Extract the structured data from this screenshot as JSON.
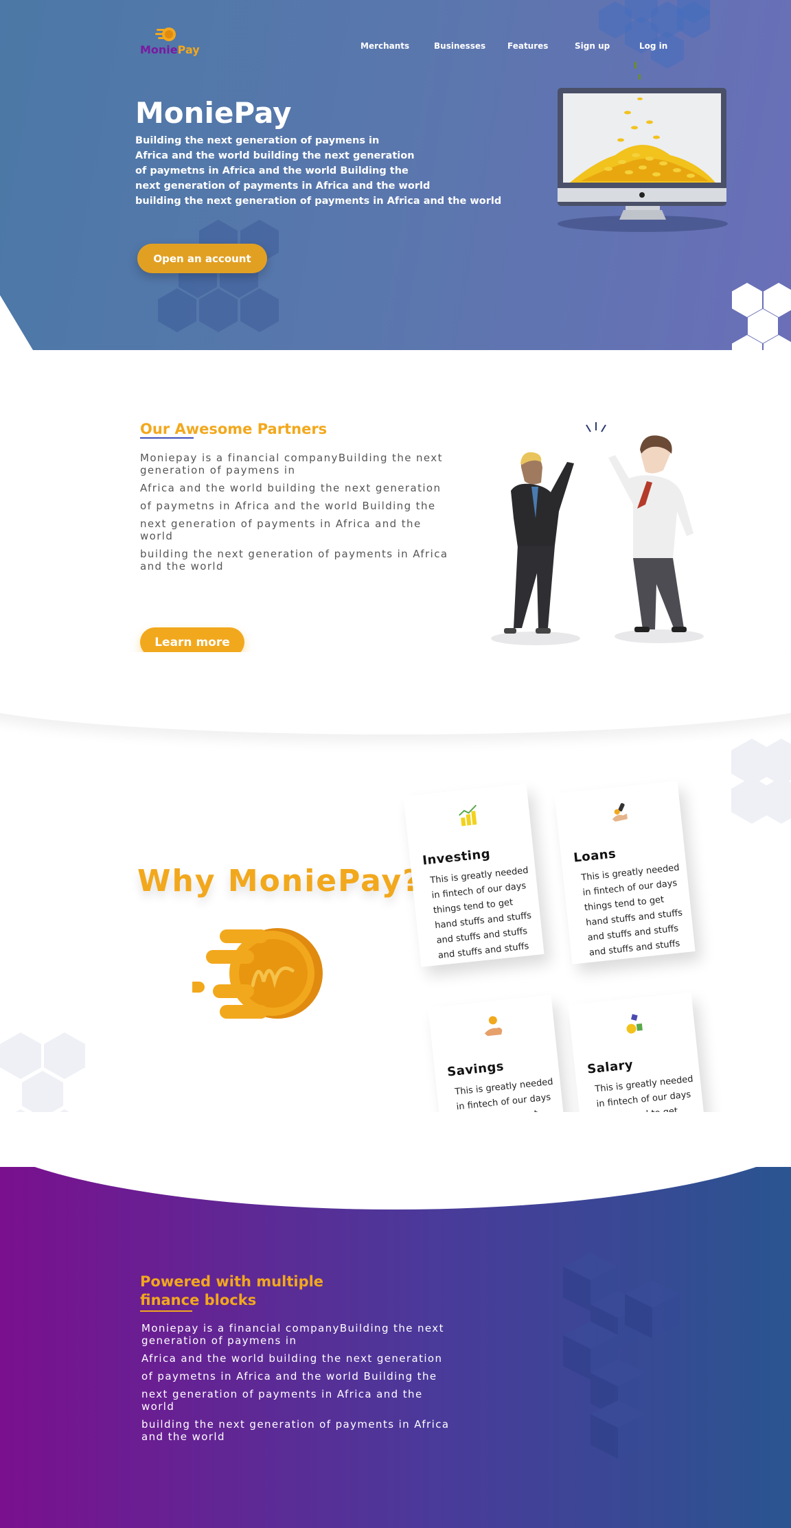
{
  "brand": {
    "part1": "Monie",
    "part2": "Pay"
  },
  "nav": {
    "items": [
      "Merchants",
      "Businesses",
      "Features",
      "Sign up",
      "Log in"
    ]
  },
  "hero": {
    "title": "MoniePay",
    "lines": [
      "Building the next generation of paymens in",
      "Africa and the world building the next generation",
      "of paymetns in Africa and the world Building the",
      "next generation of payments in Africa and the world",
      "building the next generation of payments in Africa and the world"
    ],
    "cta": "Open an account"
  },
  "partners": {
    "title": "Our Awesome Partners",
    "lines": [
      "Moniepay is a financial companyBuilding the next generation of paymens in",
      "Africa and the world building the next generation",
      "of paymetns in Africa and the world Building the",
      "next generation of payments in Africa and the world",
      "building the next generation of payments in Africa and the world"
    ],
    "cta": "Learn more"
  },
  "why": {
    "title": "Why MoniePay?",
    "cards": [
      {
        "title": "Investing",
        "icon": "chart-icon",
        "text": "This is greatly needed in fintech of our days things tend to get hand stuffs and stuffs and stuffs and stuffs and stuffs and stuffs"
      },
      {
        "title": "Loans",
        "icon": "loan-hand-icon",
        "text": "This is greatly needed in fintech of our days things tend to get hand stuffs and stuffs and stuffs and stuffs and stuffs and stuffs"
      },
      {
        "title": "Savings",
        "icon": "savings-hand-icon",
        "text": "This is greatly needed in fintech of our days things tend to get hand stuffs and stuffs and stuffs and stuffs and stuffs and stuffs"
      },
      {
        "title": "Salary",
        "icon": "salary-icon",
        "text": "This is greatly needed in fintech of our days things tend to get hand stuffs and stuffs and stuffs and stuffs and stuffs and stuffs"
      }
    ]
  },
  "powered": {
    "title": "Powered with multiple finance blocks",
    "lines": [
      "Moniepay is a financial companyBuilding the next generation of paymens in",
      "Africa and the world building the next generation",
      "of paymetns in Africa and the world Building the",
      "next generation of payments in Africa and the world",
      "building the next generation of payments in Africa and the world"
    ]
  },
  "colors": {
    "accent": "#f2a81d",
    "purple": "#7a1aa0",
    "hero_from": "#4b78a6",
    "hero_to": "#6a6fb8"
  }
}
